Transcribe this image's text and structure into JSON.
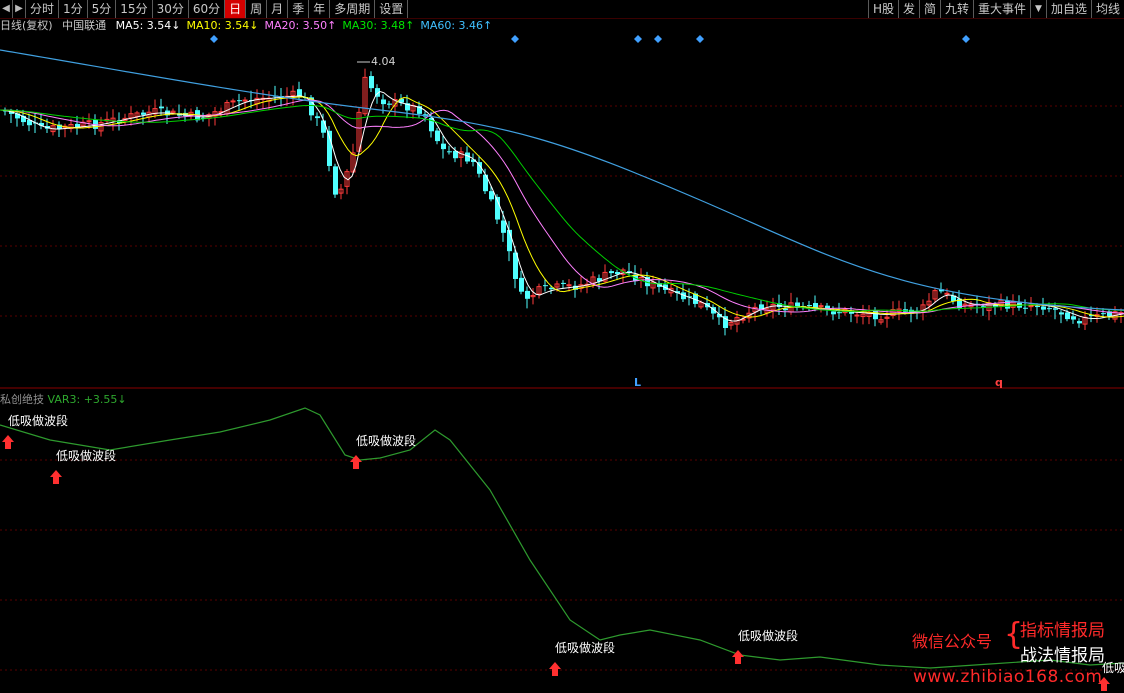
{
  "toolbar": {
    "left_buttons": [
      "分时",
      "1分",
      "5分",
      "15分",
      "30分",
      "60分",
      "日",
      "周",
      "月",
      "季",
      "年",
      "多周期",
      "设置"
    ],
    "active_index": 6,
    "right_buttons": [
      "H股",
      "发",
      "简",
      "九转",
      "重大事件",
      "加自选",
      "均线"
    ],
    "nav_prev_icon": "arrow-left-icon",
    "nav_next_icon": "arrow-right-icon",
    "dropdown_icon": "caret-down-icon"
  },
  "main_legend": {
    "period_label": "日线(复权)",
    "stock_name": "中国联通",
    "ma": [
      {
        "label": "MA5: 3.54",
        "arrow": "↓",
        "color": "#ffffff"
      },
      {
        "label": "MA10: 3.54",
        "arrow": "↓",
        "color": "#ffff00"
      },
      {
        "label": "MA20: 3.50",
        "arrow": "↑",
        "color": "#ff80ff"
      },
      {
        "label": "MA30: 3.48",
        "arrow": "↑",
        "color": "#00e600"
      },
      {
        "label": "MA60: 3.46",
        "arrow": "↑",
        "color": "#40c0ff"
      }
    ],
    "high_marker": "4.04",
    "event_markers": [
      "L",
      "q"
    ]
  },
  "sub_legend": {
    "indicator": "私创绝技",
    "var_label": "VAR3: +3.55",
    "arrow": "↓",
    "signal_text": "低吸做波段",
    "signal_text_cut": "低吸"
  },
  "watermark": {
    "line1": "微信公众号",
    "line2": "指标情报局",
    "line3": "战法情报局",
    "url": "www.zhibiao168.com"
  },
  "colors": {
    "up": "#ff3c3c",
    "down": "#50ffff",
    "active_tab": "#d40000",
    "grid": "#5a0000",
    "sub_line": "#2e9a2e",
    "signal_arrow": "#ff3030",
    "diamond": "#40a0ff"
  }
}
